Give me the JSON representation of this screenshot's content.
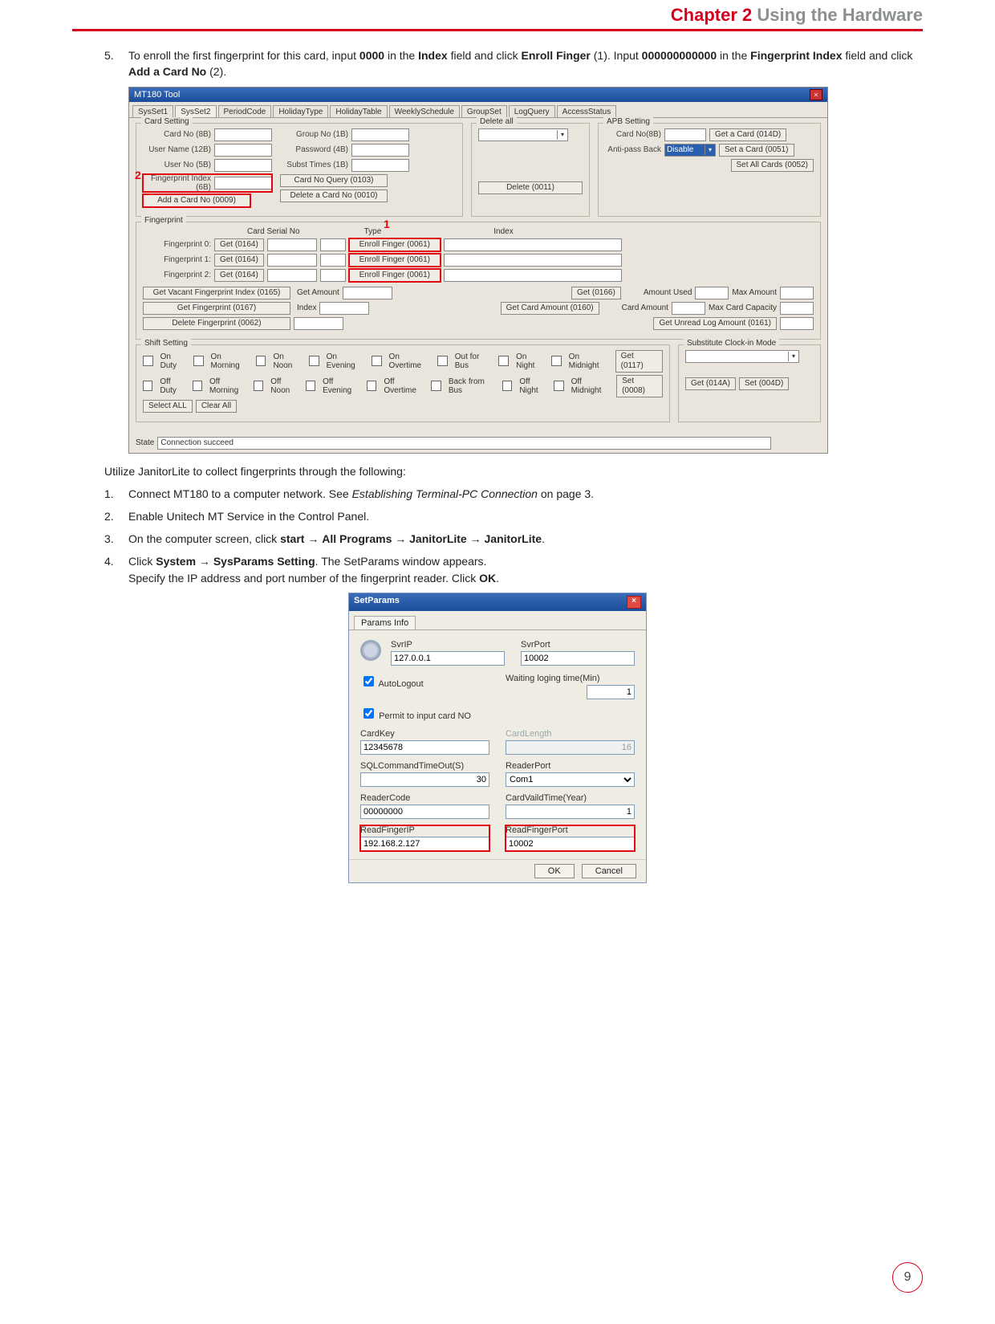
{
  "chapter": {
    "num": "Chapter 2",
    "title": "Using the Hardware"
  },
  "step5": {
    "num": "5.",
    "text_a": "To enroll the first fingerprint for this card, input ",
    "bold_a": "0000",
    "text_b": " in the ",
    "bold_b": "Index",
    "text_c": " field and click ",
    "bold_c": "Enroll Finger",
    "text_d": " (1). Input ",
    "bold_d": "000000000000",
    "text_e": " in the ",
    "bold_e": "Fingerprint Index",
    "text_f": " field and click ",
    "bold_f": "Add a Card No",
    "text_g": " (2)."
  },
  "mt180": {
    "title": "MT180 Tool",
    "tabs": [
      "SysSet1",
      "SysSet2",
      "PeriodCode",
      "HolidayType",
      "HolidayTable",
      "WeeklySchedule",
      "GroupSet",
      "LogQuery",
      "AccessStatus"
    ],
    "card_setting": "Card Setting",
    "labels": {
      "cardno": "Card No (8B)",
      "username": "User Name (12B)",
      "userno": "User No (5B)",
      "fpindex": "Fingerprint Index (6B)",
      "groupno": "Group No (1B)",
      "password": "Password (4B)",
      "subst": "Subst Times (1B)"
    },
    "buttons": {
      "addcard": "Add a Card No (0009)",
      "cardquery": "Card No Query (0103)",
      "delcard": "Delete a Card No (0010)",
      "delall": "Delete all",
      "delete": "Delete (0011)",
      "getcard": "Get a Card (014D)",
      "setcard": "Set a Card (0051)",
      "setall": "Set All Cards (0052)"
    },
    "apb": {
      "label": "APB Setting",
      "cardno": "Card No(8B)",
      "anti": "Anti-pass Back",
      "val": "Disable"
    },
    "fingerprint": {
      "label": "Fingerprint",
      "serial": "Card Serial No",
      "type": "Type",
      "index": "Index",
      "rows": [
        "Fingerprint 0:",
        "Fingerprint 1:",
        "Fingerprint 2:"
      ],
      "get": "Get (0164)",
      "enroll": "Enroll Finger (0061)"
    },
    "misc": {
      "getvacant": "Get Vacant Fingerprint Index (0165)",
      "getfp": "Get Fingerprint (0167)",
      "delfp": "Delete Fingerprint (0062)",
      "getamt": "Get Amount",
      "idx": "Index",
      "get0166": "Get (0166)",
      "amtused": "Amount Used",
      "maxamt": "Max Amount",
      "getcardamt": "Get Card Amount (0160)",
      "cardamt": "Card Amount",
      "maxcap": "Max Card Capacity",
      "getunread": "Get Unread Log Amount (0161)"
    },
    "shift": {
      "label": "Shift Setting",
      "onduty": "On Duty",
      "onmorn": "On Morning",
      "onnoon": "On Noon",
      "oneve": "On Evening",
      "onover": "On Overtime",
      "outbus": "Out for Bus",
      "onnight": "On Night",
      "onmid": "On Midnight",
      "offduty": "Off Duty",
      "offmorn": "Off Morning",
      "offnoon": "Off Noon",
      "offeve": "Off Evening",
      "offover": "Off Overtime",
      "backbus": "Back from Bus",
      "offnight": "Off Night",
      "offmid": "Off Midnight",
      "get": "Get (0117)",
      "set": "Set (0008)",
      "sub": "Substitute Clock-in Mode",
      "get014a": "Get (014A)",
      "set004d": "Set (004D)",
      "selall": "Select ALL",
      "clrall": "Clear All"
    },
    "state": {
      "label": "State",
      "val": "Connection succeed"
    },
    "c1": "1",
    "c2": "2"
  },
  "intro": "Utilize JanitorLite to collect fingerprints through the following:",
  "s1": {
    "num": "1.",
    "a": "Connect MT180 to a computer network. See ",
    "i": "Establishing Terminal-PC Connection",
    "b": " on page 3."
  },
  "s2": {
    "num": "2.",
    "a": "Enable Unitech MT Service in the Control Panel."
  },
  "s3": {
    "num": "3.",
    "a": "On the computer screen, click ",
    "b1": "start",
    "arr": " → ",
    "b2": "All Programs",
    "b3": "JanitorLite",
    "b4": "JanitorLite",
    "end": "."
  },
  "s4": {
    "num": "4.",
    "a": "Click ",
    "b1": "System",
    "arr": " → ",
    "b2": "SysParams Setting",
    "c": ". The SetParams window appears.",
    "d": "Specify the IP address and port number of the fingerprint reader. Click ",
    "ok": "OK",
    "e": "."
  },
  "setparams": {
    "title": "SetParams",
    "tab": "Params Info",
    "svrip": {
      "label": "SvrIP",
      "val": "127.0.0.1"
    },
    "svrport": {
      "label": "SvrPort",
      "val": "10002"
    },
    "autologout": "AutoLogout",
    "permit": "Permit to input card NO",
    "waiting": {
      "label": "Waiting loging time(Min)",
      "val": "1"
    },
    "cardkey": {
      "label": "CardKey",
      "val": "12345678"
    },
    "cardlen": {
      "label": "CardLength",
      "val": "16"
    },
    "sqlto": {
      "label": "SQLCommandTimeOut(S)",
      "val": "30"
    },
    "readerport": {
      "label": "ReaderPort",
      "val": "Com1"
    },
    "readercode": {
      "label": "ReaderCode",
      "val": "00000000"
    },
    "cardvalid": {
      "label": "CardVaildTime(Year)",
      "val": "1"
    },
    "readfip": {
      "label": "ReadFingerIP",
      "val": "192.168.2.127"
    },
    "readfport": {
      "label": "ReadFingerPort",
      "val": "10002"
    },
    "ok": "OK",
    "cancel": "Cancel"
  },
  "pagenum": "9"
}
